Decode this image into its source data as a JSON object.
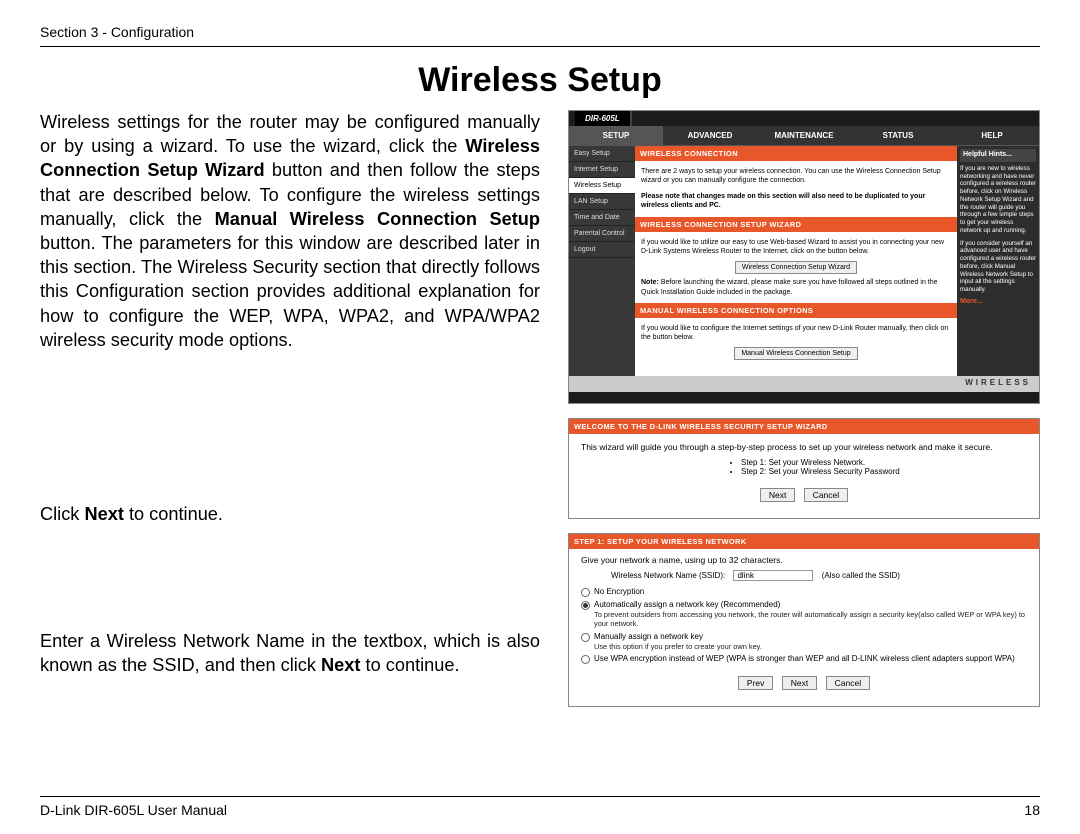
{
  "header": {
    "section": "Section 3 - Configuration"
  },
  "title": "Wireless Setup",
  "intro": {
    "pre": "Wireless settings for the router may be configured manually or by using a wizard. To use the wizard, click the ",
    "b1": "Wireless Connection Setup Wizard",
    "mid1": " button and then follow the steps that are described below. To configure the wireless settings manually, click the ",
    "b2": "Manual Wireless Connection Setup",
    "post": " button. The parameters for this window are described later in this section. The Wireless Security section that directly follows this Configuration section provides  additional explanation for how to configure the WEP, WPA, WPA2, and WPA/WPA2 wireless security mode options."
  },
  "para2": {
    "pre": "Click ",
    "b": "Next",
    "post": " to continue."
  },
  "para3": {
    "pre": "Enter a Wireless Network Name in the textbox, which is also known as the SSID, and then click ",
    "b": "Next",
    "post": " to continue."
  },
  "router": {
    "product": "DIR-605L",
    "tabs": [
      "SETUP",
      "ADVANCED",
      "MAINTENANCE",
      "STATUS",
      "HELP"
    ],
    "sidebar": [
      "Easy Setup",
      "Internet Setup",
      "Wireless Setup",
      "LAN Setup",
      "Time and Date",
      "Parental Control",
      "Logout"
    ],
    "active_sidebar_index": 2,
    "section1_title": "WIRELESS CONNECTION",
    "section1_body": "There are 2 ways to setup your wireless connection. You can use the Wireless Connection Setup wizard or you can manually configure the connection.",
    "section1_note": "Please note that changes made on this section will also need to be duplicated to your wireless clients and PC.",
    "section2_title": "WIRELESS CONNECTION SETUP WIZARD",
    "section2_body": "If you would like to utilize our easy to use Web-based Wizard to assist you in connecting your new D-Link Systems Wireless Router to the Internet, click on the button below.",
    "section2_btn": "Wireless Connection Setup Wizard",
    "section2_note_b": "Note:",
    "section2_note": "Before launching the wizard, please make sure you have followed all steps outlined in the Quick Installation Guide included in the package.",
    "section3_title": "MANUAL WIRELESS CONNECTION OPTIONS",
    "section3_body": "If you would like to configure the Internet settings of your new D-Link Router manually, then click on the button below.",
    "section3_btn": "Manual Wireless Connection Setup",
    "footer_word": "WIRELESS",
    "help_title": "Helpful Hints...",
    "help_body1": "If you are new to wireless networking and have never configured a wireless router before, click on Wireless Network Setup Wizard and the router will guide you through a few simple steps to get your wireless network up and running.",
    "help_body2": "If you consider yourself an advanced user and have configured a wireless router before, click Manual Wireless Network Setup to input all the settings manually.",
    "help_more": "More..."
  },
  "wiz1": {
    "title": "WELCOME TO THE D-LINK WIRELESS SECURITY SETUP WIZARD",
    "body": "This wizard will guide you through a step-by-step process to set up your wireless network and make it secure.",
    "step1": "Step 1: Set your Wireless Network.",
    "step2": "Step 2: Set your Wireless Security Password",
    "btn_next": "Next",
    "btn_cancel": "Cancel"
  },
  "wiz2": {
    "title": "STEP 1: SETUP YOUR WIRELESS NETWORK",
    "body": "Give your network a name, using up to 32 characters.",
    "ssid_label": "Wireless Network Name (SSID):",
    "ssid_value": "dlink",
    "ssid_hint": "(Also called the SSID)",
    "opt1": "No Encryption",
    "opt2": "Automatically assign a network key (Recommended)",
    "opt2_sub": "To prevent outsiders from accessing you network, the router will automatically assign a security key(also called WEP or WPA key) to your network.",
    "opt3": "Manually assign a network key",
    "opt3_sub": "Use this option if you prefer to create your own key.",
    "opt4": "Use WPA encryption instead of WEP (WPA is stronger than WEP and all D-LINK wireless client adapters support WPA)",
    "btn_prev": "Prev",
    "btn_next": "Next",
    "btn_cancel": "Cancel"
  },
  "footer": {
    "manual": "D-Link DIR-605L User Manual",
    "page": "18"
  }
}
